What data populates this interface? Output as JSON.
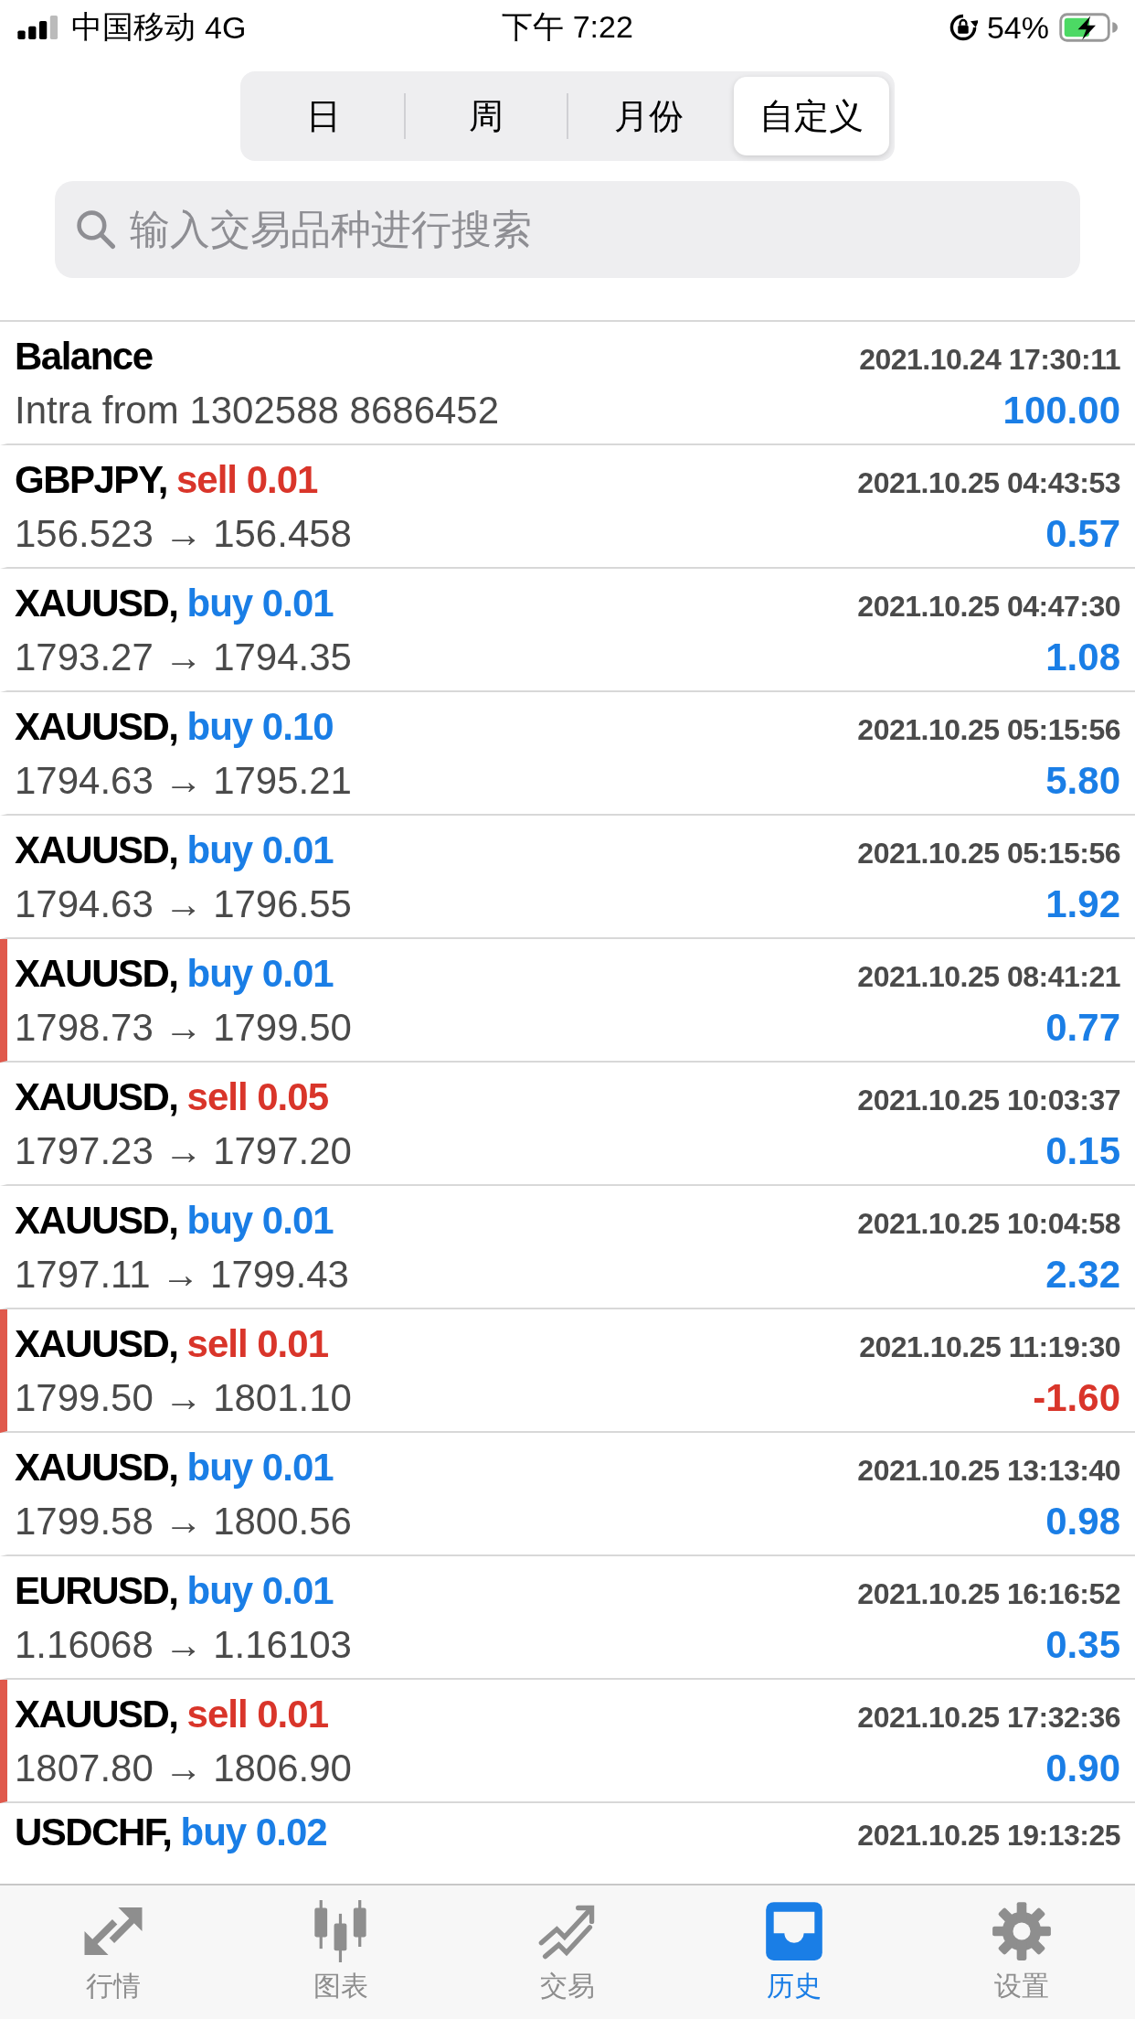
{
  "status_bar": {
    "carrier": "中国移动",
    "network": "4G",
    "time": "下午 7:22",
    "battery": "54%"
  },
  "segments": [
    {
      "label": "日",
      "selected": false
    },
    {
      "label": "周",
      "selected": false
    },
    {
      "label": "月份",
      "selected": false
    },
    {
      "label": "自定义",
      "selected": true
    }
  ],
  "search": {
    "placeholder": "输入交易品种进行搜索"
  },
  "balance": {
    "title": "Balance",
    "time": "2021.10.24 17:30:11",
    "comment": "Intra from 1302588 8686452",
    "amount": "100.00"
  },
  "deals": [
    {
      "symbol": "GBPJPY,",
      "kind": "sell",
      "order": "sell 0.01",
      "time": "2021.10.25 04:43:53",
      "prices": "156.523 → 156.458",
      "profit": "0.57",
      "loss": false,
      "marked": false
    },
    {
      "symbol": "XAUUSD,",
      "kind": "buy",
      "order": "buy 0.01",
      "time": "2021.10.25 04:47:30",
      "prices": "1793.27 → 1794.35",
      "profit": "1.08",
      "loss": false,
      "marked": false
    },
    {
      "symbol": "XAUUSD,",
      "kind": "buy",
      "order": "buy 0.10",
      "time": "2021.10.25 05:15:56",
      "prices": "1794.63 → 1795.21",
      "profit": "5.80",
      "loss": false,
      "marked": false
    },
    {
      "symbol": "XAUUSD,",
      "kind": "buy",
      "order": "buy 0.01",
      "time": "2021.10.25 05:15:56",
      "prices": "1794.63 → 1796.55",
      "profit": "1.92",
      "loss": false,
      "marked": false
    },
    {
      "symbol": "XAUUSD,",
      "kind": "buy",
      "order": "buy 0.01",
      "time": "2021.10.25 08:41:21",
      "prices": "1798.73 → 1799.50",
      "profit": "0.77",
      "loss": false,
      "marked": true
    },
    {
      "symbol": "XAUUSD,",
      "kind": "sell",
      "order": "sell 0.05",
      "time": "2021.10.25 10:03:37",
      "prices": "1797.23 → 1797.20",
      "profit": "0.15",
      "loss": false,
      "marked": false
    },
    {
      "symbol": "XAUUSD,",
      "kind": "buy",
      "order": "buy 0.01",
      "time": "2021.10.25 10:04:58",
      "prices": "1797.11 → 1799.43",
      "profit": "2.32",
      "loss": false,
      "marked": false
    },
    {
      "symbol": "XAUUSD,",
      "kind": "sell",
      "order": "sell 0.01",
      "time": "2021.10.25 11:19:30",
      "prices": "1799.50 → 1801.10",
      "profit": "-1.60",
      "loss": true,
      "marked": true
    },
    {
      "symbol": "XAUUSD,",
      "kind": "buy",
      "order": "buy 0.01",
      "time": "2021.10.25 13:13:40",
      "prices": "1799.58 → 1800.56",
      "profit": "0.98",
      "loss": false,
      "marked": false
    },
    {
      "symbol": "EURUSD,",
      "kind": "buy",
      "order": "buy 0.01",
      "time": "2021.10.25 16:16:52",
      "prices": "1.16068 → 1.16103",
      "profit": "0.35",
      "loss": false,
      "marked": false
    },
    {
      "symbol": "XAUUSD,",
      "kind": "sell",
      "order": "sell 0.01",
      "time": "2021.10.25 17:32:36",
      "prices": "1807.80 → 1806.90",
      "profit": "0.90",
      "loss": false,
      "marked": true
    },
    {
      "symbol": "USDCHF,",
      "kind": "buy",
      "order": "buy 0.02",
      "time": "2021.10.25 19:13:25"
    }
  ],
  "tabbar": [
    {
      "label": "行情",
      "selected": false
    },
    {
      "label": "图表",
      "selected": false
    },
    {
      "label": "交易",
      "selected": false
    },
    {
      "label": "历史",
      "selected": true
    },
    {
      "label": "设置",
      "selected": false
    }
  ]
}
